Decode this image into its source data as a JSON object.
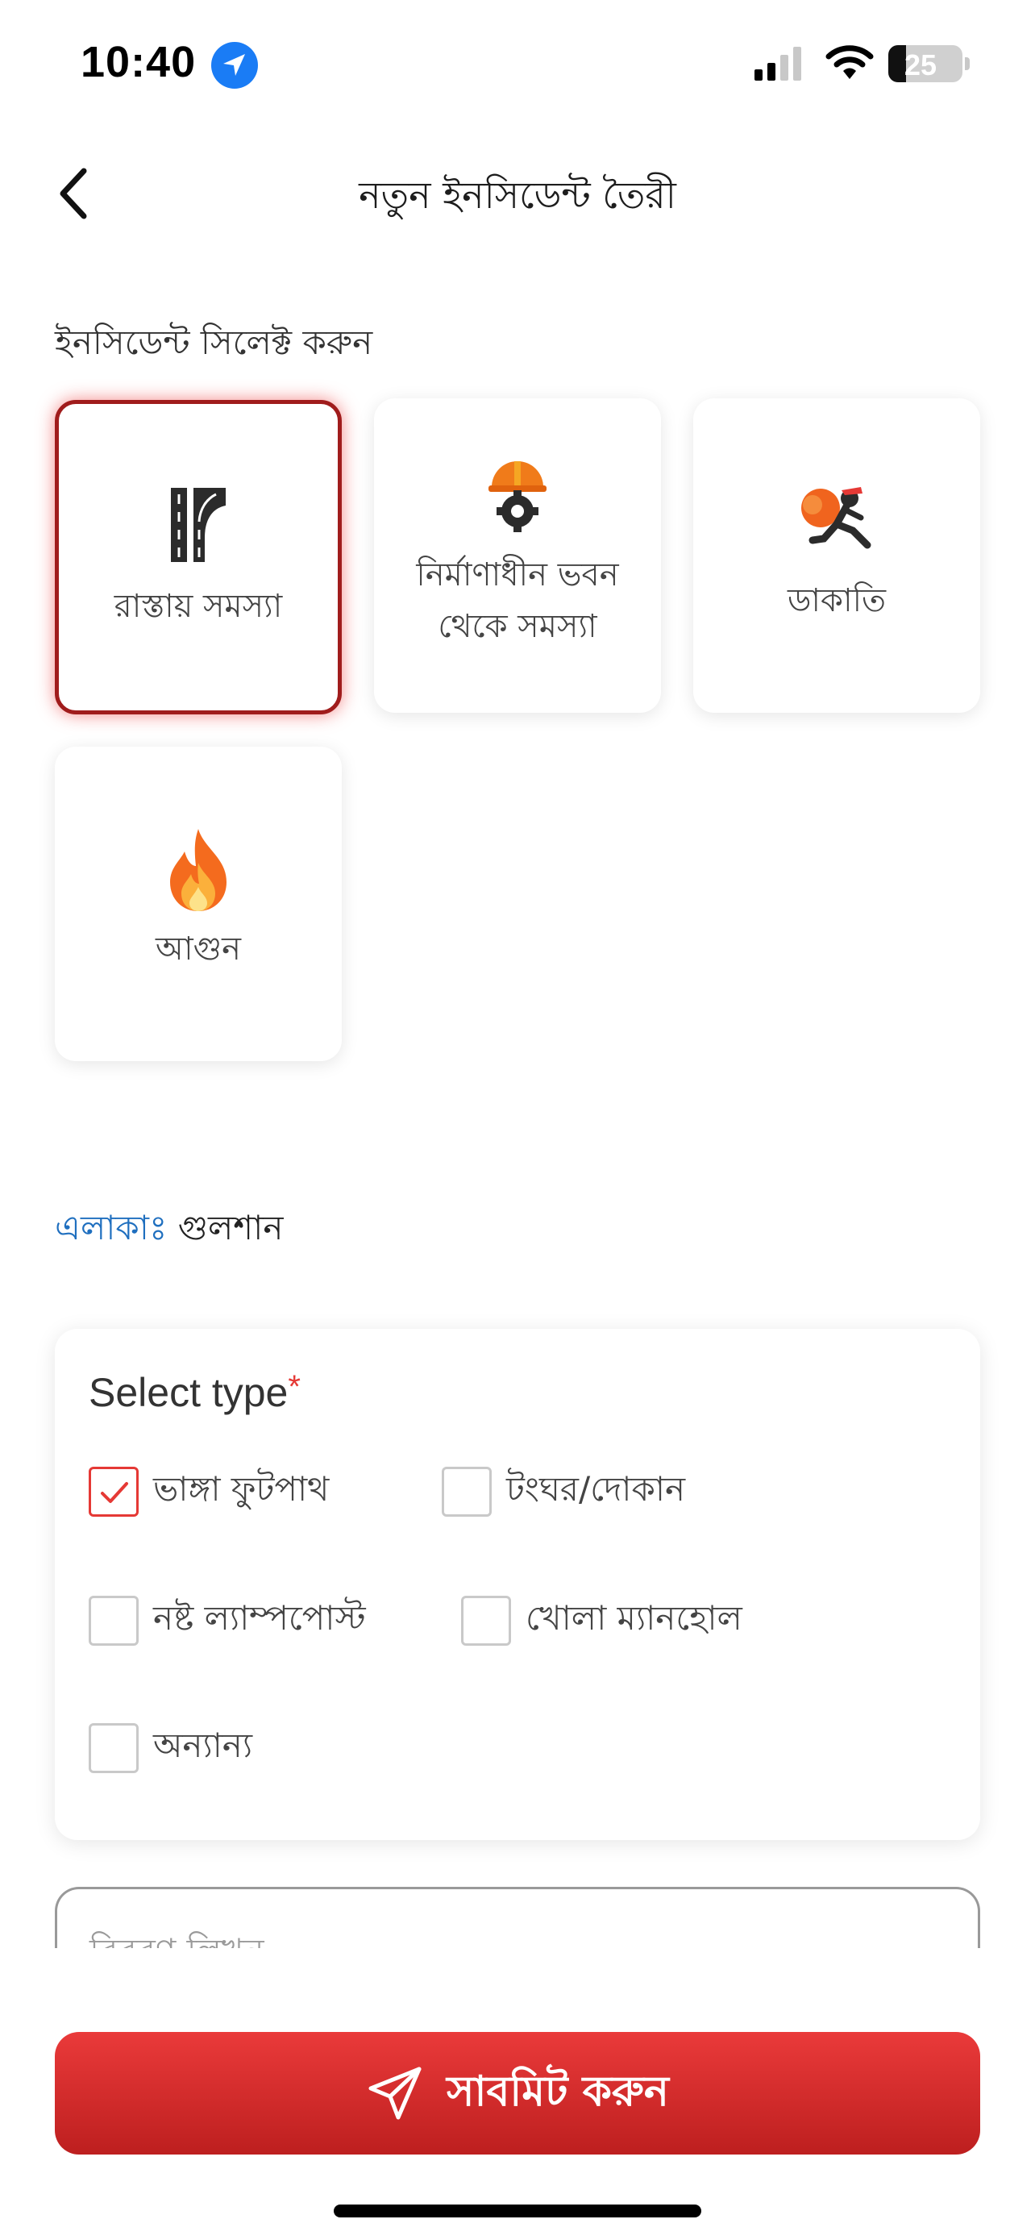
{
  "status_bar": {
    "time": "10:40",
    "battery": "25",
    "icons": [
      "location-arrow-icon",
      "signal-bars-icon",
      "wifi-icon",
      "battery-icon"
    ]
  },
  "header": {
    "title": "নতুন ইনসিডেন্ট তৈরী",
    "back_icon": "chevron-left-icon"
  },
  "incident_section": {
    "label": "ইনসিডেন্ট সিলেক্ট করুন",
    "cards": [
      {
        "label": "রাস্তায় সমস্যা",
        "icon": "road-icon",
        "selected": true
      },
      {
        "label_line1": "নির্মাণাধীন ভবন",
        "label_line2": "থেকে সমস্যা",
        "icon": "hardhat-gear-icon",
        "selected": false
      },
      {
        "label": "ডাকাতি",
        "icon": "robber-icon",
        "selected": false
      },
      {
        "label": "আগুন",
        "icon": "fire-icon",
        "selected": false
      }
    ]
  },
  "area": {
    "label": "এলাকাঃ",
    "value": "গুলশান"
  },
  "select_type": {
    "title": "Select type",
    "required_mark": "*",
    "options": [
      {
        "label": "ভাঙ্গা ফুটপাথ",
        "checked": true
      },
      {
        "label": "টংঘর/দোকান",
        "checked": false
      },
      {
        "label": "নষ্ট ল্যাম্পপোস্ট",
        "checked": false
      },
      {
        "label": "খোলা ম্যানহোল",
        "checked": false
      },
      {
        "label": "অন্যান্য",
        "checked": false
      }
    ]
  },
  "description": {
    "placeholder": "বিবরণ লিখুন"
  },
  "submit": {
    "label": "সাবমিট করুন",
    "icon": "send-icon"
  },
  "colors": {
    "accent_red": "#e53935",
    "selected_border": "#a01c1c",
    "area_label_blue": "#1f6fbf",
    "location_blue": "#1a7cf5"
  }
}
